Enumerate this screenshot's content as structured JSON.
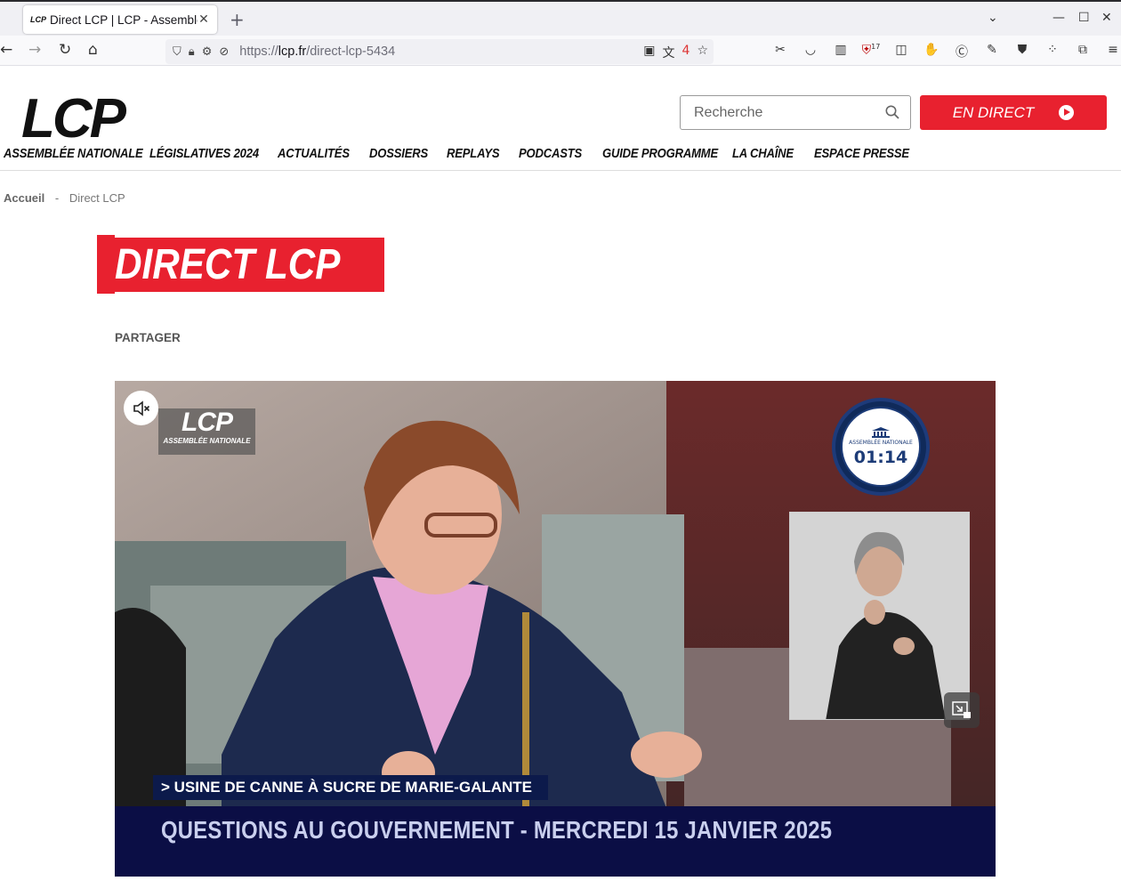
{
  "browser": {
    "tab_title": "Direct LCP | LCP - Assemblée nationale",
    "tab_favicon_text": "LCP",
    "tab_close": "✕",
    "new_tab": "+",
    "url_scheme": "https://",
    "url_host": "lcp.fr",
    "url_path": "/direct-lcp-5434",
    "toolbar_badge": "17",
    "translate_badge": "4"
  },
  "site": {
    "logo_text": "LCP",
    "logo_subtitle": "ASSEMBLÉE NATIONALE",
    "search_placeholder": "Recherche",
    "live_button_label": "EN DIRECT",
    "nav": [
      {
        "label": "LÉGISLATIVES 2024"
      },
      {
        "label": "ACTUALITÉS"
      },
      {
        "label": "DOSSIERS"
      },
      {
        "label": "REPLAYS"
      },
      {
        "label": "PODCASTS"
      },
      {
        "label": "GUIDE PROGRAMME"
      },
      {
        "label": "LA CHAÎNE"
      },
      {
        "label": "ESPACE PRESSE"
      }
    ],
    "colors": {
      "accent": "#e8212f",
      "text": "#111111"
    }
  },
  "breadcrumb": {
    "home": "Accueil",
    "separator": "-",
    "current": "Direct LCP"
  },
  "page": {
    "title": "DIRECT LCP",
    "share_label": "PARTAGER"
  },
  "video": {
    "channel_bug": "LCP",
    "channel_bug_sub": "ASSEMBLÉE NATIONALE",
    "clock_time": "01:14",
    "clock_label": "ASSEMBLÉE NATIONALE",
    "topic": "> USINE DE CANNE À SUCRE DE MARIE-GALANTE",
    "program": "QUESTIONS AU GOUVERNEMENT - MERCREDI 15 JANVIER 2025",
    "muted": true
  }
}
